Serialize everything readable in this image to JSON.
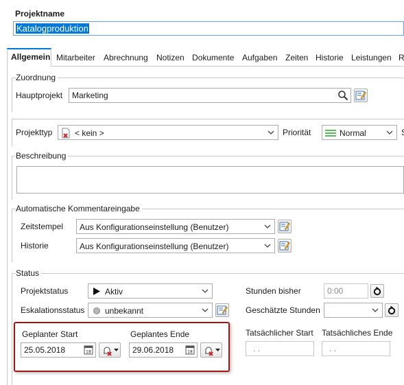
{
  "header": {
    "title_label": "Projektname",
    "name_value": "Katalogproduktion"
  },
  "tabs": [
    {
      "label": "Allgemein",
      "active": true
    },
    {
      "label": "Mitarbeiter"
    },
    {
      "label": "Abrechnung"
    },
    {
      "label": "Notizen"
    },
    {
      "label": "Dokumente"
    },
    {
      "label": "Aufgaben"
    },
    {
      "label": "Zeiten"
    },
    {
      "label": "Historie"
    },
    {
      "label": "Leistungen"
    },
    {
      "label": "R"
    }
  ],
  "zuordnung": {
    "title": "Zuordnung",
    "hauptprojekt_label": "Hauptprojekt",
    "hauptprojekt_value": "Marketing"
  },
  "typ": {
    "projekttyp_label": "Projekttyp",
    "projekttyp_value": "< kein >",
    "prioritaet_label": "Priorität",
    "prioritaet_value": "Normal",
    "cut_label": "S"
  },
  "beschreibung": {
    "title": "Beschreibung",
    "value": ""
  },
  "kommentar": {
    "title": "Automatische Kommentareingabe",
    "zeitstempel_label": "Zeitstempel",
    "zeitstempel_value": "Aus Konfigurationseinstellung (Benutzer)",
    "historie_label": "Historie",
    "historie_value": "Aus Konfigurationseinstellung (Benutzer)"
  },
  "status": {
    "title": "Status",
    "projektstatus_label": "Projektstatus",
    "projektstatus_value": "Aktiv",
    "eskalation_label": "Eskalationsstatus",
    "eskalation_value": "unbekannt",
    "stunden_bisher_label": "Stunden bisher",
    "stunden_bisher_value": "0:00",
    "geschaetzte_label": "Geschätzte Stunden",
    "geschaetzte_value": "",
    "geplanter_start_label": "Geplanter Start",
    "geplanter_start_value": "25.05.2018",
    "geplantes_ende_label": "Geplantes Ende",
    "geplantes_ende_value": "29.06.2018",
    "tats_start_label": "Tatsächlicher Start",
    "tats_start_value": ". .",
    "tats_ende_label": "Tatsächliches Ende",
    "tats_ende_value": ". .",
    "highlight_color": "#a31515"
  },
  "colors": {
    "accent": "#0078d7",
    "selection": "#0078d7",
    "priority_green": "#5cb85c"
  }
}
